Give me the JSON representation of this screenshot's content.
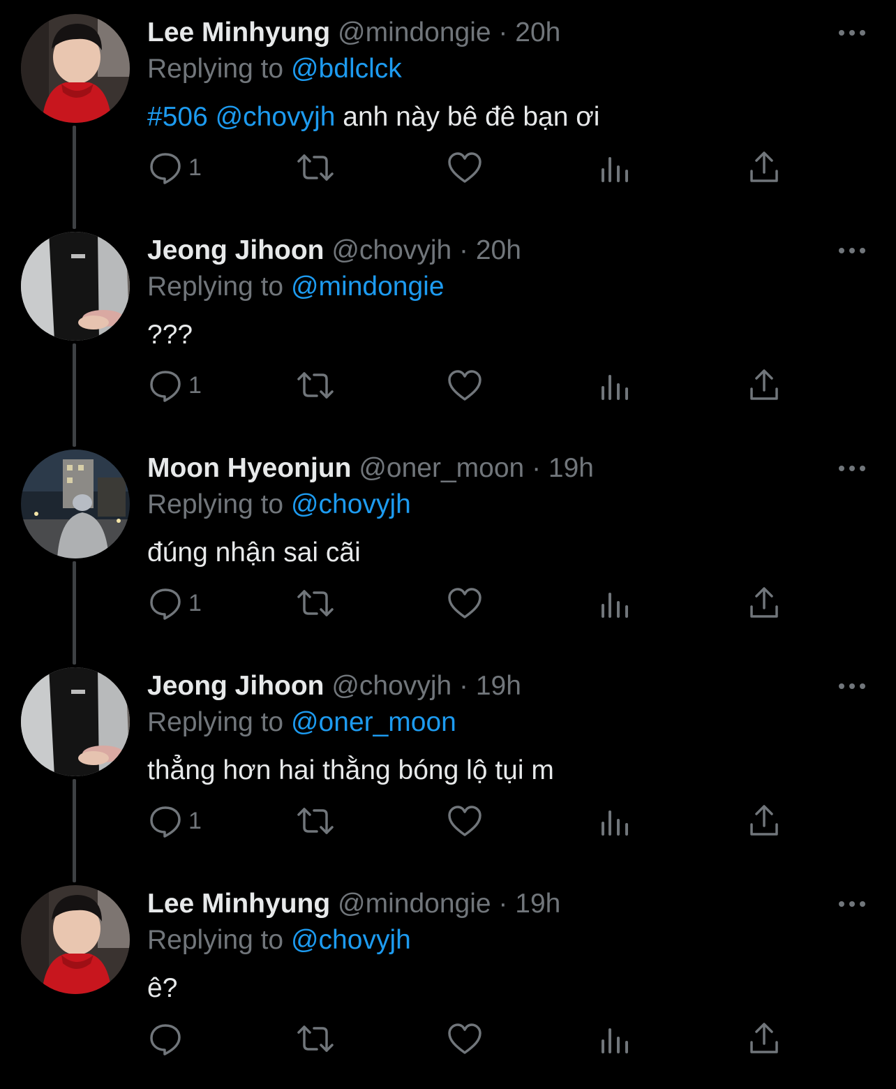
{
  "thread": {
    "tweets": [
      {
        "name": "Lee Minhyung",
        "handle": "@mindongie",
        "separator": "·",
        "time": "20h",
        "replying_prefix": "Replying to",
        "replying_handle": "@bdlclck",
        "content_links": "#506 @chovyjh",
        "content_text": "anh này bê đê bạn ơi",
        "reply_count": "1",
        "avatar": "lee-minhyung-photo"
      },
      {
        "name": "Jeong Jihoon",
        "handle": "@chovyjh",
        "separator": "·",
        "time": "20h",
        "replying_prefix": "Replying to",
        "replying_handle": "@mindongie",
        "content_links": "",
        "content_text": "???",
        "reply_count": "1",
        "avatar": "jeong-jihoon-photo"
      },
      {
        "name": "Moon Hyeonjun",
        "handle": "@oner_moon",
        "separator": "·",
        "time": "19h",
        "replying_prefix": "Replying to",
        "replying_handle": "@chovyjh",
        "content_links": "",
        "content_text": "đúng nhận sai cãi",
        "reply_count": "1",
        "avatar": "moon-hyeonjun-photo"
      },
      {
        "name": "Jeong Jihoon",
        "handle": "@chovyjh",
        "separator": "·",
        "time": "19h",
        "replying_prefix": "Replying to",
        "replying_handle": "@oner_moon",
        "content_links": "",
        "content_text": "thẳng hơn hai thằng bóng lộ tụi m",
        "reply_count": "1",
        "avatar": "jeong-jihoon-photo"
      },
      {
        "name": "Lee Minhyung",
        "handle": "@mindongie",
        "separator": "·",
        "time": "19h",
        "replying_prefix": "Replying to",
        "replying_handle": "@chovyjh",
        "content_links": "",
        "content_text": "ê?",
        "reply_count": "",
        "avatar": "lee-minhyung-photo"
      }
    ]
  },
  "icons": {
    "reply": "reply-icon",
    "retweet": "retweet-icon",
    "like": "like-icon",
    "views": "views-icon",
    "share": "share-icon",
    "more": "more-icon"
  },
  "colors": {
    "background": "#000000",
    "text": "#e7e9ea",
    "secondary": "#71767b",
    "link": "#1d9bf0",
    "thread_line": "#3e4144"
  }
}
